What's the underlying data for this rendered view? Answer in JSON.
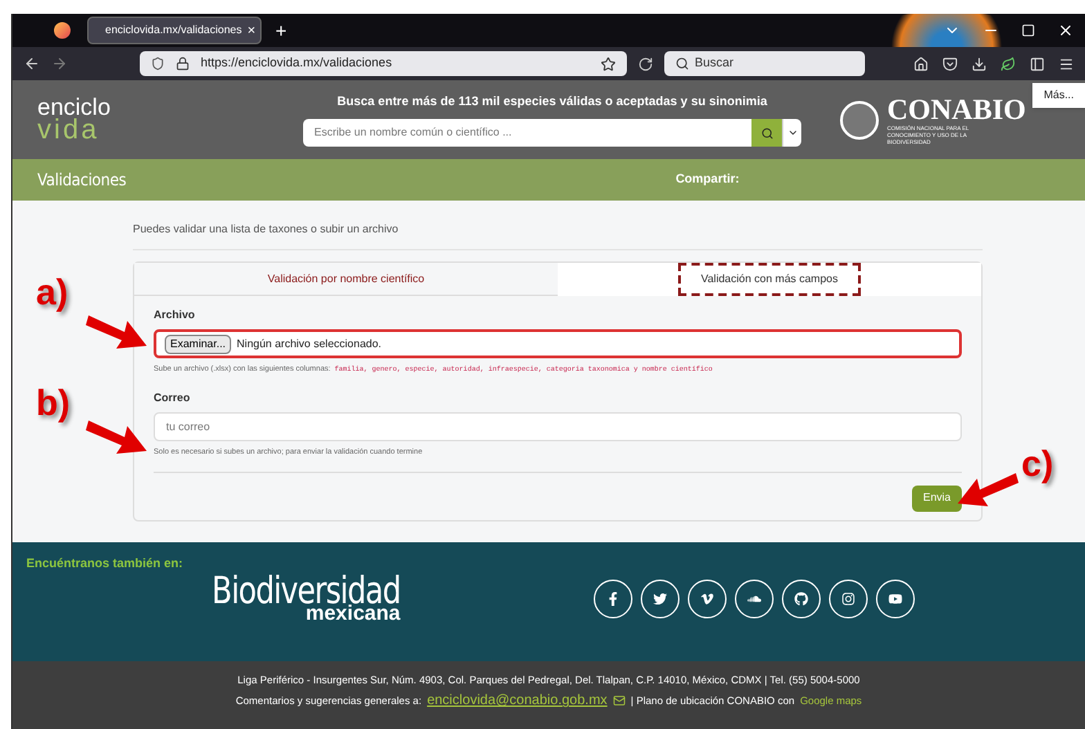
{
  "browser": {
    "tab_title": "enciclovida.mx/validaciones",
    "tab_close": "×",
    "new_tab": "+",
    "url": "https://enciclovida.mx/validaciones",
    "search_placeholder": "Buscar",
    "tooltip": "Más..."
  },
  "header": {
    "logo_top": "enciclo",
    "logo_bottom": "vida",
    "tagline": "Busca entre más de 113 mil especies válidas o aceptadas y su sinonimia",
    "search_placeholder": "Escribe un nombre común o científico ...",
    "org_name": "CONABIO",
    "org_subtitle": "COMISIÓN NACIONAL PARA EL CONOCIMIENTO Y USO DE LA BIODIVERSIDAD"
  },
  "page_bar": {
    "title": "Validaciones",
    "share_label": "Compartir:"
  },
  "intro": "Puedes validar una lista de taxones o subir un archivo",
  "tabs": [
    {
      "label": "Validación por nombre científico",
      "selected": false,
      "highlighted": false
    },
    {
      "label": "Validación con más campos",
      "selected": true,
      "highlighted": true
    }
  ],
  "fields": [
    {
      "kind": "file",
      "label": "Archivo",
      "button": "Examinar...",
      "status": "Ningún archivo seleccionado.",
      "highlighted": true,
      "hint": "Sube un archivo (.xlsx) con las siguientes columnas:",
      "hint_code": "familia, genero, especie, autoridad, infraespecie, categoria taxonomica y nombre científico"
    },
    {
      "kind": "email",
      "label": "Correo",
      "placeholder": "tu correo",
      "highlighted": false,
      "hint": "Solo es necesario si subes un archivo; para enviar la validación cuando termine"
    }
  ],
  "submit": "Envia",
  "annotations": [
    {
      "label": "a)"
    },
    {
      "label": "b)"
    },
    {
      "label": "c)"
    }
  ],
  "footer": {
    "follow_label": "Encuéntranos también en:",
    "brand_top": "Biodiversidad",
    "brand_bottom": "mexicana",
    "address": "Liga Periférico - Insurgentes Sur, Núm. 4903, Col. Parques del Pedregal, Del. Tlalpan, C.P. 14010, México, CDMX | Tel. (55) 5004-5000",
    "contact_prefix": "Comentarios y sugerencias generales a:",
    "email": "enciclovida@conabio.gob.mx",
    "map_prefix": "| Plano de ubicación CONABIO con",
    "map_link": "Google maps"
  }
}
